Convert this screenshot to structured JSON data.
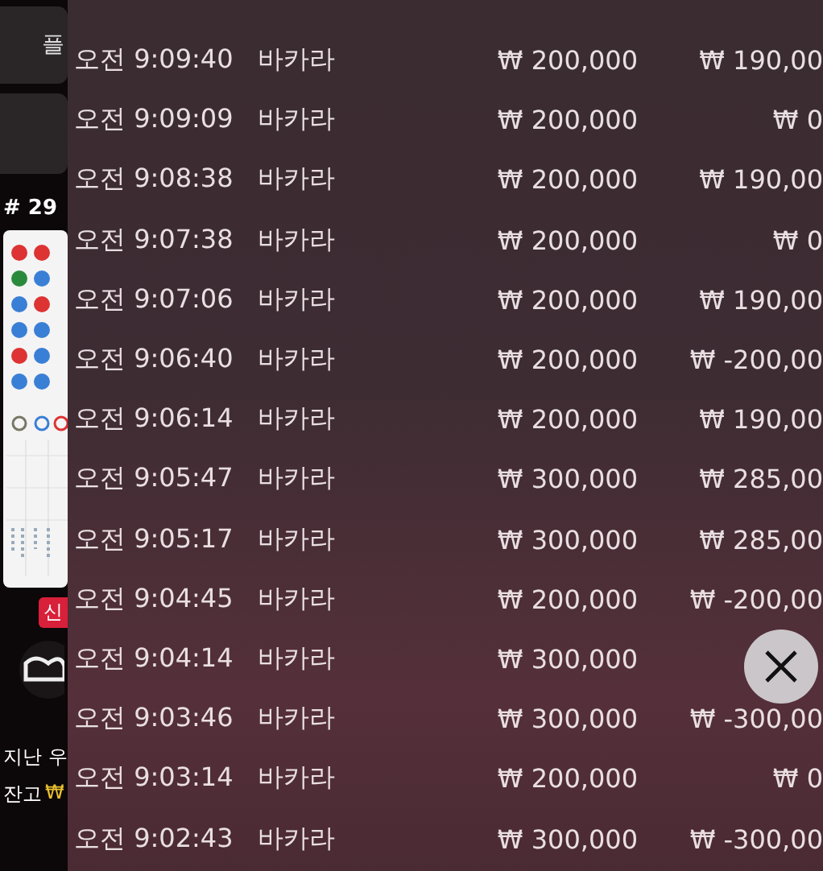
{
  "background": {
    "top_button": "플",
    "round_label": "# 29",
    "badge": "신",
    "last_label": "지난 우",
    "balance_label": "잔고",
    "balance_currency": "₩"
  },
  "history": {
    "rows": [
      {
        "time": "오전 9:09:40",
        "game": "바카라",
        "bet": "₩ 200,000",
        "result": "₩ 190,00"
      },
      {
        "time": "오전 9:09:09",
        "game": "바카라",
        "bet": "₩ 200,000",
        "result": "₩ 0"
      },
      {
        "time": "오전 9:08:38",
        "game": "바카라",
        "bet": "₩ 200,000",
        "result": "₩ 190,00"
      },
      {
        "time": "오전 9:07:38",
        "game": "바카라",
        "bet": "₩ 200,000",
        "result": "₩ 0"
      },
      {
        "time": "오전 9:07:06",
        "game": "바카라",
        "bet": "₩ 200,000",
        "result": "₩ 190,00"
      },
      {
        "time": "오전 9:06:40",
        "game": "바카라",
        "bet": "₩ 200,000",
        "result": "₩ -200,00"
      },
      {
        "time": "오전 9:06:14",
        "game": "바카라",
        "bet": "₩ 200,000",
        "result": "₩ 190,00"
      },
      {
        "time": "오전 9:05:47",
        "game": "바카라",
        "bet": "₩ 300,000",
        "result": "₩ 285,00"
      },
      {
        "time": "오전 9:05:17",
        "game": "바카라",
        "bet": "₩ 300,000",
        "result": "₩ 285,00"
      },
      {
        "time": "오전 9:04:45",
        "game": "바카라",
        "bet": "₩ 200,000",
        "result": "₩ -200,00"
      },
      {
        "time": "오전 9:04:14",
        "game": "바카라",
        "bet": "₩ 300,000"
      },
      {
        "time": "오전 9:03:46",
        "game": "바카라",
        "bet": "₩ 300,000",
        "result": "₩ -300,00"
      },
      {
        "time": "오전 9:03:14",
        "game": "바카라",
        "bet": "₩ 200,000",
        "result": "₩ 0"
      },
      {
        "time": "오전 9:02:43",
        "game": "바카라",
        "bet": "₩ 300,000",
        "result": "₩ -300,00"
      }
    ]
  }
}
